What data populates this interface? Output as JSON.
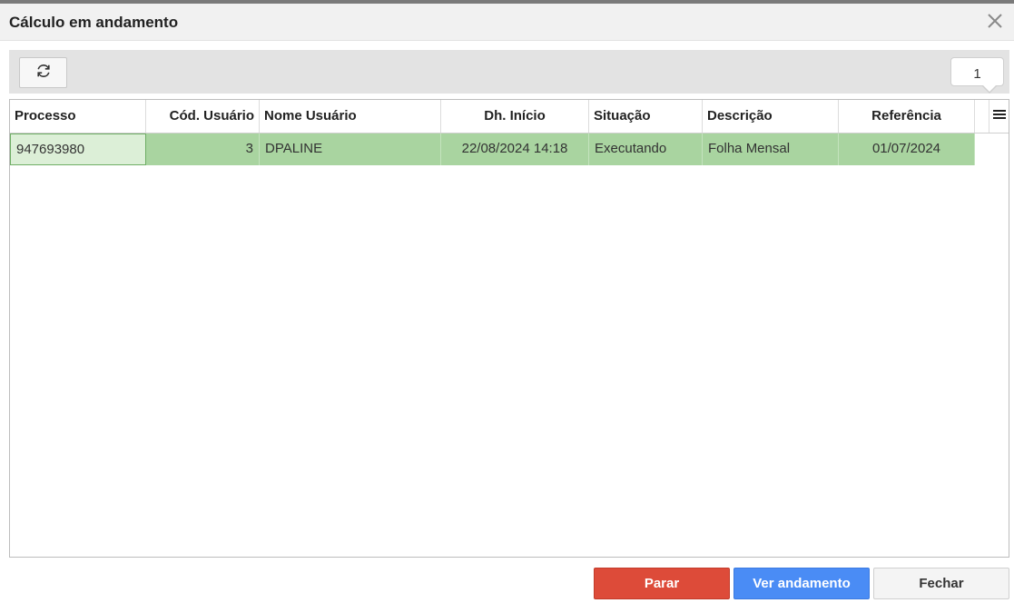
{
  "dialog": {
    "title": "Cálculo em andamento",
    "close_icon": "close-icon"
  },
  "toolbar": {
    "refresh_icon": "refresh-icon",
    "record_count": "1"
  },
  "grid": {
    "columns": [
      "Processo",
      "Cód. Usuário",
      "Nome Usuário",
      "Dh. Início",
      "Situação",
      "Descrição",
      "Referência"
    ],
    "column_menu_icon": "hamburger-menu-icon",
    "rows": [
      [
        "947693980",
        "3",
        "DPALINE",
        "22/08/2024 14:18",
        "Executando",
        "Folha Mensal",
        "01/07/2024"
      ]
    ],
    "selected_row_color": "#a9d4a0"
  },
  "footer": {
    "stop_label": "Parar",
    "view_progress_label": "Ver andamento",
    "close_label": "Fechar",
    "stop_color": "#dd4b39",
    "view_progress_color": "#4a8cf5"
  }
}
